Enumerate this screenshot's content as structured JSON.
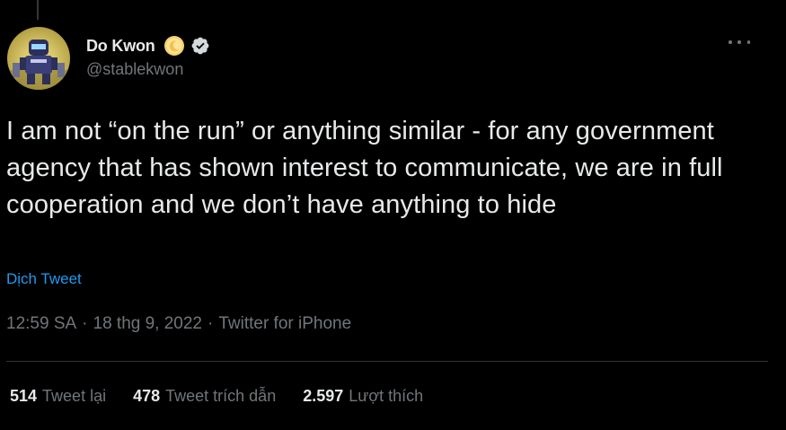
{
  "author": {
    "display_name": "Do Kwon",
    "handle": "@stablekwon",
    "avatar_icon": "avatar-character",
    "badge_icon": "moon-icon",
    "verified_icon": "verified-badge-icon"
  },
  "tweet": {
    "text": "I am not “on the run” or anything similar - for any government agency that has shown interest to communicate, we are in full cooperation and we don’t have anything to hide",
    "translate_label": "Dịch Tweet",
    "time": "12:59 SA",
    "date": "18 thg 9, 2022",
    "source": "Twitter for iPhone",
    "separator": "·"
  },
  "stats": {
    "retweets": {
      "count": "514",
      "label": "Tweet lại"
    },
    "quotes": {
      "count": "478",
      "label": "Tweet trích dẫn"
    },
    "likes": {
      "count": "2.597",
      "label": "Lượt thích"
    }
  },
  "colors": {
    "background": "#000000",
    "text": "#e7e9ea",
    "secondary": "#71767b",
    "link": "#1d9bf0",
    "divider": "#2f3336"
  }
}
